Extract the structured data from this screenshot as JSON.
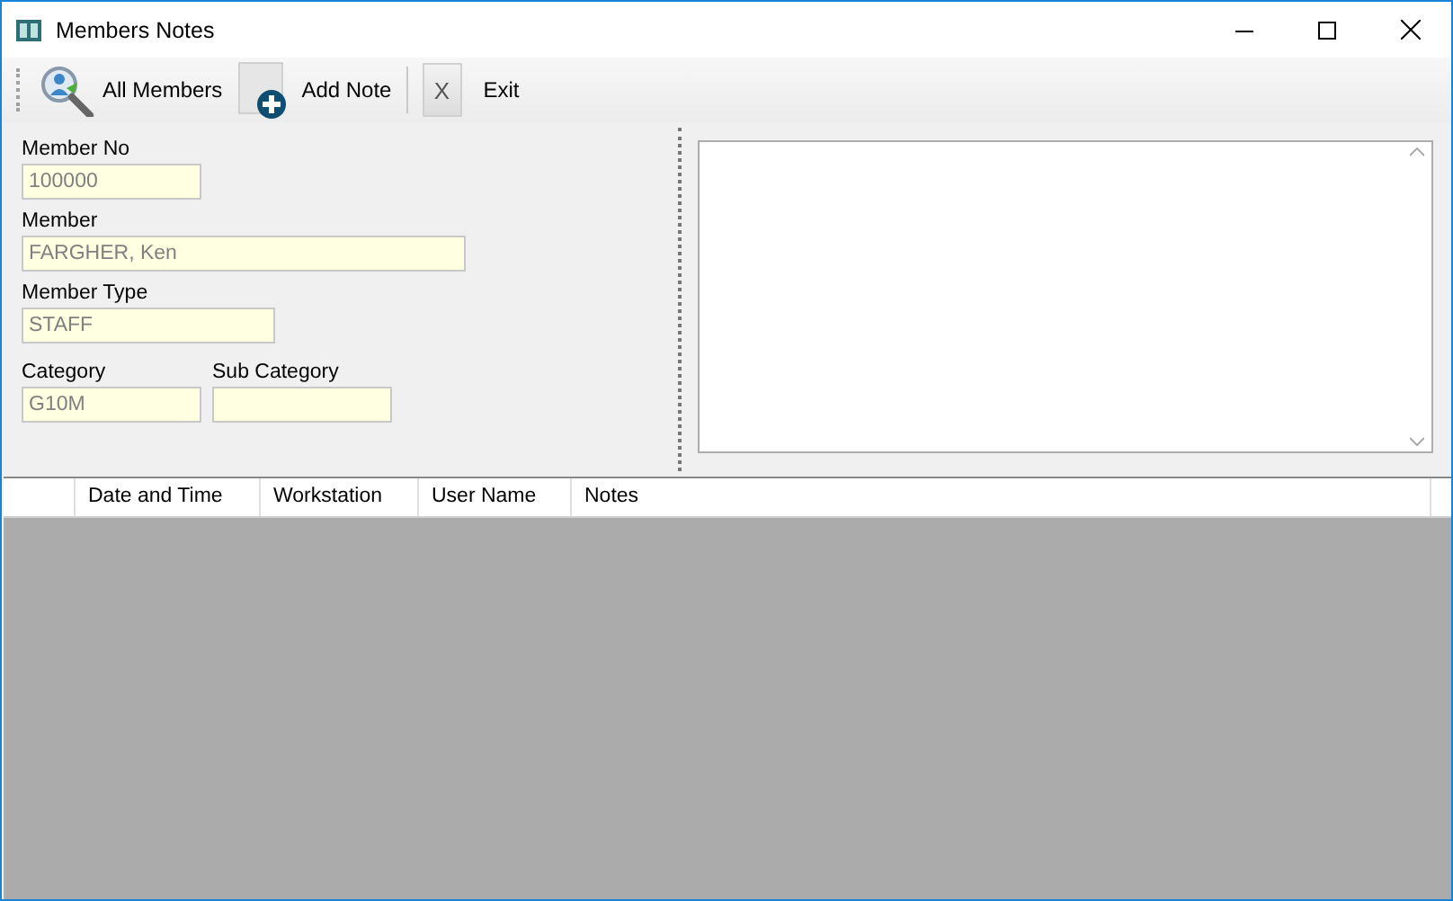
{
  "window": {
    "title": "Members Notes"
  },
  "toolbar": [
    {
      "kind": "search",
      "label": "All Members"
    },
    {
      "kind": "add",
      "label": "Add Note"
    },
    {
      "kind": "exit",
      "icon_text": "X",
      "label": "Exit"
    }
  ],
  "form": {
    "fields": [
      {
        "label": "Member No",
        "value": "100000"
      },
      {
        "label": "Member",
        "value": "FARGHER, Ken"
      },
      {
        "label": "Member Type",
        "value": "STAFF"
      }
    ],
    "pair": [
      {
        "label": "Category",
        "value": "G10M"
      },
      {
        "label": "Sub Category"
      }
    ]
  },
  "table": {
    "columns": [
      "Date and Time",
      "Workstation",
      "User Name",
      "Notes"
    ]
  }
}
